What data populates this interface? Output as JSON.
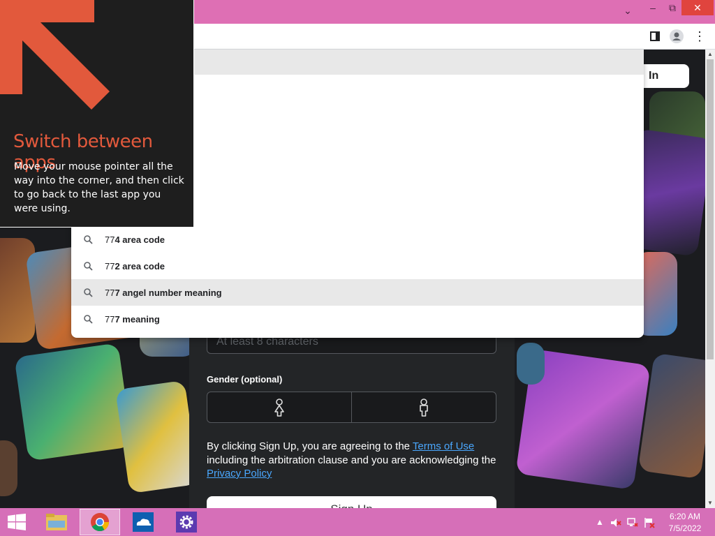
{
  "browser": {
    "window_controls": {
      "tab_search": "⌄",
      "minimize": "–",
      "maximize": "⧉",
      "close": "✕"
    },
    "menu_icon": "⋮"
  },
  "page": {
    "login_label": "In",
    "password_placeholder": "At least 8 characters",
    "gender_label": "Gender (optional)",
    "terms": {
      "prefix": "By clicking Sign Up, you are agreeing to the ",
      "terms_link": "Terms of Use",
      "middle": " including the arbitration clause and you are acknowledging the ",
      "privacy_link": "Privacy Policy"
    },
    "signup_label": "Sign Up"
  },
  "omnibox": {
    "suggestions": [
      {
        "typed": "77",
        "rest": "4 area code",
        "highlighted": false
      },
      {
        "typed": "77",
        "rest": "2 area code",
        "highlighted": false
      },
      {
        "typed": "77",
        "rest": "7 angel number meaning",
        "highlighted": true
      },
      {
        "typed": "77",
        "rest": "7 meaning",
        "highlighted": false
      }
    ]
  },
  "tip": {
    "title": "Switch between apps",
    "body": "Move your mouse pointer all the way into the corner, and then click to go back to the last app you were using."
  },
  "taskbar": {
    "apps": [
      {
        "name": "start-button",
        "icon": "windows-logo-icon"
      },
      {
        "name": "file-explorer",
        "icon": "folder-icon"
      },
      {
        "name": "chrome",
        "icon": "chrome-icon",
        "active": true
      },
      {
        "name": "onedrive",
        "icon": "cloud-icon"
      },
      {
        "name": "settings",
        "icon": "gear-icon"
      }
    ],
    "time": "6:20 AM",
    "date": "7/5/2022"
  },
  "colors": {
    "titlebar": "#de6fb4",
    "taskbar": "#d66fb8",
    "tip_title": "#e2593c",
    "link": "#4aa8ff"
  }
}
